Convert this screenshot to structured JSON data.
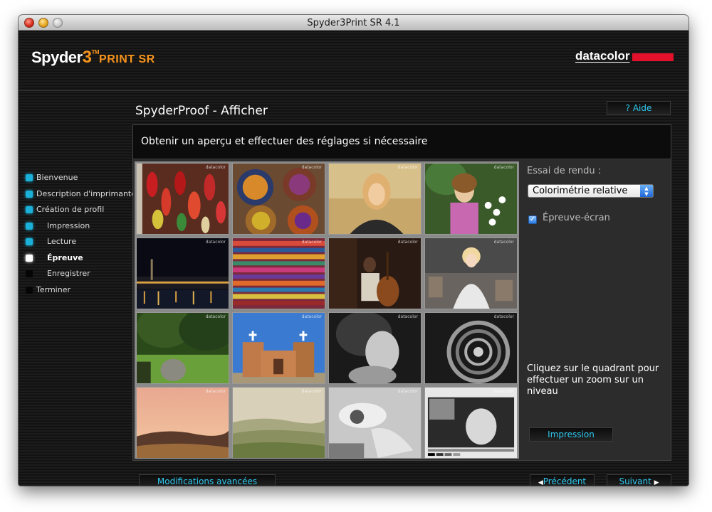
{
  "window": {
    "title": "Spyder3Print SR 4.1"
  },
  "header": {
    "logo_main": "Spyder",
    "logo_num": "3",
    "logo_tm": "TM",
    "logo_print": "PRINT SR",
    "brand": "datacolor"
  },
  "sidebar": {
    "steps": [
      {
        "label": "Bienvenue",
        "state": "done"
      },
      {
        "label": "Description d'imprimante",
        "state": "done"
      },
      {
        "label": "Création de profil",
        "state": "done"
      },
      {
        "label": "Impression",
        "state": "done"
      },
      {
        "label": "Lecture",
        "state": "done"
      },
      {
        "label": "Épreuve",
        "state": "active"
      },
      {
        "label": "Enregistrer",
        "state": "pending"
      },
      {
        "label": "Terminer",
        "state": "pending"
      }
    ]
  },
  "main": {
    "title": "SpyderProof - Afficher",
    "help_label": "Aide",
    "subtitle": "Obtenir un aperçu et effectuer des réglages si nécessaire",
    "rendering_label": "Essai de rendu :",
    "rendering_value": "Colorimétrie relative",
    "softproof_label": "Épreuve-écran",
    "softproof_checked": true,
    "zoom_hint": "Cliquez sur le quadrant pour effectuer un zoom sur un niveau",
    "print_button": "Impression",
    "watermark": "datacolor"
  },
  "footer": {
    "advanced_label": "Modifications avancées",
    "prev_label": "Précédent",
    "next_label": "Suivant"
  },
  "colors": {
    "accent_cyan": "#2ec8ee",
    "step_done": "#1ab0d8",
    "brand_red": "#e3102b",
    "logo_orange": "#f7941d"
  }
}
